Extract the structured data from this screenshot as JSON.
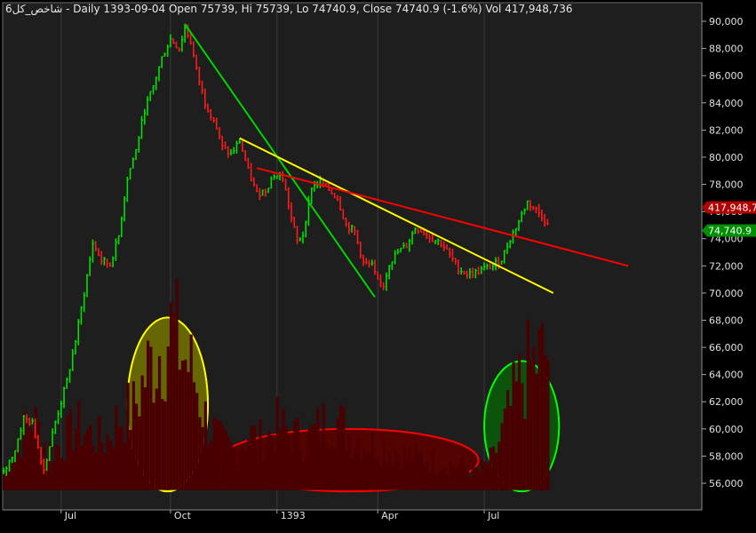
{
  "header": {
    "symbol": "6شاخص_کل",
    "text": " - Daily 1393-09-04 Open 75739, Hi 75739, Lo 74740.9, Close 74740.9 (-1.6%) Vol 417,948,736"
  },
  "chart_data": {
    "type": "candlestick",
    "ylim": [
      55000,
      91000
    ],
    "y_ticks": [
      56000,
      58000,
      60000,
      62000,
      64000,
      66000,
      68000,
      70000,
      72000,
      74000,
      76000,
      78000,
      80000,
      82000,
      84000,
      86000,
      88000,
      90000
    ],
    "y_tick_labels": [
      "56,000",
      "58,000",
      "60,000",
      "62,000",
      "64,000",
      "66,000",
      "68,000",
      "70,000",
      "72,000",
      "74,000",
      "76,000",
      "78,000",
      "80,000",
      "82,000",
      "84,000",
      "86,000",
      "88,000",
      "90,000"
    ],
    "x_ticks": [
      {
        "label": "Jul",
        "bar": 20
      },
      {
        "label": "Oct",
        "bar": 58
      },
      {
        "label": "1393",
        "bar": 95
      },
      {
        "label": "Apr",
        "bar": 130
      },
      {
        "label": "Jul",
        "bar": 167
      }
    ],
    "bar_count": 230,
    "close_points": [
      [
        0,
        56700
      ],
      [
        4,
        58500
      ],
      [
        7,
        60800
      ],
      [
        10,
        60400
      ],
      [
        14,
        57000
      ],
      [
        18,
        60500
      ],
      [
        22,
        63500
      ],
      [
        25,
        66500
      ],
      [
        28,
        70000
      ],
      [
        31,
        73700
      ],
      [
        34,
        72400
      ],
      [
        37,
        72100
      ],
      [
        40,
        74200
      ],
      [
        43,
        78500
      ],
      [
        46,
        80500
      ],
      [
        49,
        83500
      ],
      [
        52,
        85200
      ],
      [
        55,
        87300
      ],
      [
        58,
        88700
      ],
      [
        61,
        88000
      ],
      [
        63,
        89500
      ],
      [
        65,
        88500
      ],
      [
        67,
        86400
      ],
      [
        70,
        84000
      ],
      [
        73,
        82800
      ],
      [
        76,
        80700
      ],
      [
        79,
        80200
      ],
      [
        82,
        81200
      ],
      [
        85,
        79000
      ],
      [
        88,
        77300
      ],
      [
        91,
        77600
      ],
      [
        94,
        78700
      ],
      [
        97,
        78500
      ],
      [
        100,
        75500
      ],
      [
        102,
        73800
      ],
      [
        104,
        74300
      ],
      [
        107,
        77800
      ],
      [
        110,
        78200
      ],
      [
        113,
        77600
      ],
      [
        116,
        77000
      ],
      [
        119,
        75000
      ],
      [
        122,
        74500
      ],
      [
        125,
        72200
      ],
      [
        128,
        72000
      ],
      [
        130,
        70800
      ],
      [
        132,
        70600
      ],
      [
        134,
        72200
      ],
      [
        137,
        73000
      ],
      [
        140,
        73500
      ],
      [
        143,
        74800
      ],
      [
        146,
        74500
      ],
      [
        149,
        74000
      ],
      [
        152,
        73700
      ],
      [
        155,
        72800
      ],
      [
        158,
        71800
      ],
      [
        161,
        71400
      ],
      [
        164,
        71500
      ],
      [
        167,
        71800
      ],
      [
        170,
        72000
      ],
      [
        173,
        72500
      ],
      [
        176,
        74000
      ],
      [
        179,
        75300
      ],
      [
        182,
        76700
      ],
      [
        184,
        76300
      ],
      [
        187,
        75700
      ],
      [
        189,
        75000
      ]
    ],
    "volume_profile": [
      [
        0,
        0.1
      ],
      [
        5,
        0.3
      ],
      [
        10,
        0.45
      ],
      [
        15,
        0.25
      ],
      [
        20,
        0.28
      ],
      [
        25,
        0.4
      ],
      [
        30,
        0.35
      ],
      [
        35,
        0.3
      ],
      [
        40,
        0.45
      ],
      [
        45,
        0.5
      ],
      [
        50,
        0.75
      ],
      [
        55,
        0.9
      ],
      [
        58,
        1.0
      ],
      [
        62,
        0.85
      ],
      [
        66,
        0.7
      ],
      [
        70,
        0.45
      ],
      [
        75,
        0.3
      ],
      [
        80,
        0.25
      ],
      [
        85,
        0.35
      ],
      [
        90,
        0.3
      ],
      [
        95,
        0.4
      ],
      [
        100,
        0.35
      ],
      [
        105,
        0.3
      ],
      [
        110,
        0.4
      ],
      [
        115,
        0.45
      ],
      [
        120,
        0.35
      ],
      [
        125,
        0.3
      ],
      [
        130,
        0.28
      ],
      [
        135,
        0.25
      ],
      [
        140,
        0.22
      ],
      [
        145,
        0.2
      ],
      [
        150,
        0.18
      ],
      [
        155,
        0.16
      ],
      [
        160,
        0.14
      ],
      [
        165,
        0.12
      ],
      [
        170,
        0.2
      ],
      [
        175,
        0.45
      ],
      [
        180,
        0.7
      ],
      [
        185,
        0.8
      ],
      [
        189,
        0.85
      ]
    ],
    "trendlines": [
      {
        "color": "#00d400",
        "from": [
          63,
          89800
        ],
        "to": [
          129,
          69700
        ]
      },
      {
        "color": "#ffff00",
        "from": [
          82,
          81400
        ],
        "to": [
          191,
          70000
        ]
      },
      {
        "color": "#ff0000",
        "from": [
          88,
          79200
        ],
        "to": [
          217,
          72000
        ]
      }
    ],
    "ellipses": [
      {
        "stroke": "#ffff00",
        "fill": "#6e6e00",
        "cx": 57,
        "cy_value": 61800,
        "rx_bars": 14,
        "ry_value": 6400
      },
      {
        "stroke": "#ff0000",
        "fill": "#5a0000",
        "cx": 120,
        "cy_value": 57700,
        "rx_bars": 45,
        "ry_value": 2300
      },
      {
        "stroke": "#00ff00",
        "fill": "#0a5a0a",
        "cx": 180,
        "cy_value": 60200,
        "rx_bars": 13,
        "ry_value": 4800
      }
    ],
    "last_labels": [
      {
        "text": "417,948,7",
        "value": 76300,
        "bg": "#b00000"
      },
      {
        "text": "74,740.9",
        "value": 74600,
        "bg": "#008f00"
      }
    ]
  }
}
